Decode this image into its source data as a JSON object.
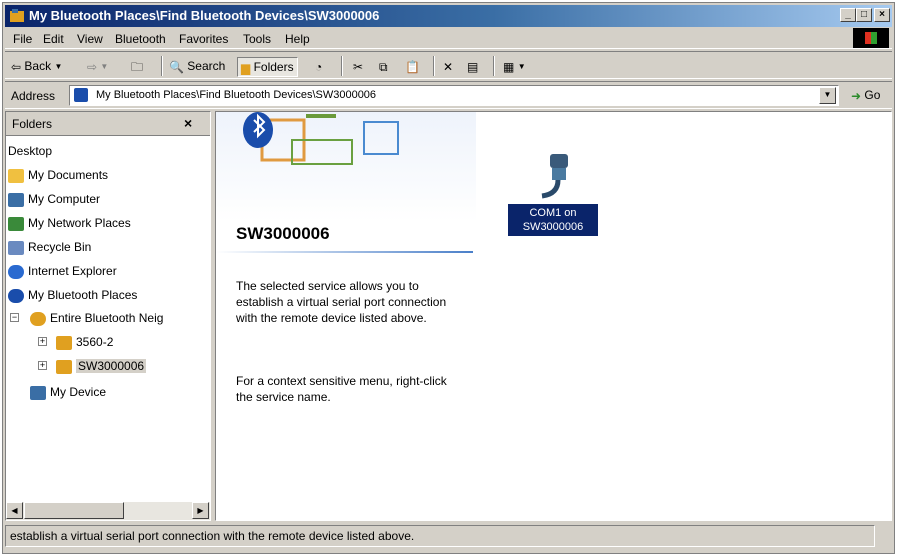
{
  "window": {
    "title": "My Bluetooth Places\\Find Bluetooth Devices\\SW3000006",
    "min": "_",
    "max": "□",
    "close": "×"
  },
  "menu": [
    "File",
    "Edit",
    "View",
    "Bluetooth",
    "Favorites",
    "Tools",
    "Help"
  ],
  "toolbar": {
    "back": "Back",
    "search": "Search",
    "folders": "Folders"
  },
  "address": {
    "label": "Address",
    "value": "My Bluetooth Places\\Find Bluetooth Devices\\SW3000006",
    "go": "Go"
  },
  "folders": {
    "title": "Folders",
    "close": "×",
    "items": [
      {
        "label": "Desktop",
        "icon": "desktop-icon"
      },
      {
        "label": "My Documents",
        "icon": "folder-icon",
        "color": "#f0c040"
      },
      {
        "label": "My Computer",
        "icon": "computer-icon",
        "color": "#3a6ea5"
      },
      {
        "label": "My Network Places",
        "icon": "network-icon",
        "color": "#3a8a3a"
      },
      {
        "label": "Recycle Bin",
        "icon": "recycle-bin-icon",
        "color": "#6a8ac0"
      },
      {
        "label": "Internet Explorer",
        "icon": "ie-icon",
        "color": "#2a6ad0"
      },
      {
        "label": "My Bluetooth Places",
        "icon": "bluetooth-icon",
        "color": "#1a4dab"
      },
      {
        "label": "Entire Bluetooth Neig",
        "icon": "globe-icon",
        "color": "#e0a020"
      },
      {
        "label": "3560-2",
        "icon": "device-icon",
        "color": "#e0a020"
      },
      {
        "label": "SW3000006",
        "icon": "device-icon",
        "color": "#e0a020"
      },
      {
        "label": "My Device",
        "icon": "laptop-icon",
        "color": "#3a6ea5"
      }
    ]
  },
  "content": {
    "heading": "SW3000006",
    "description": "The selected service allows you to establish a virtual serial port connection with the remote device listed above.",
    "hint": "For a context sensitive menu, right-click the service name.",
    "service_label": "COM1 on SW3000006"
  },
  "status": {
    "text": "establish a virtual serial port connection with the remote device listed above."
  },
  "colors": {
    "title_active": "#0a246a",
    "selection": "#0a246a",
    "face": "#d4d0c8"
  }
}
